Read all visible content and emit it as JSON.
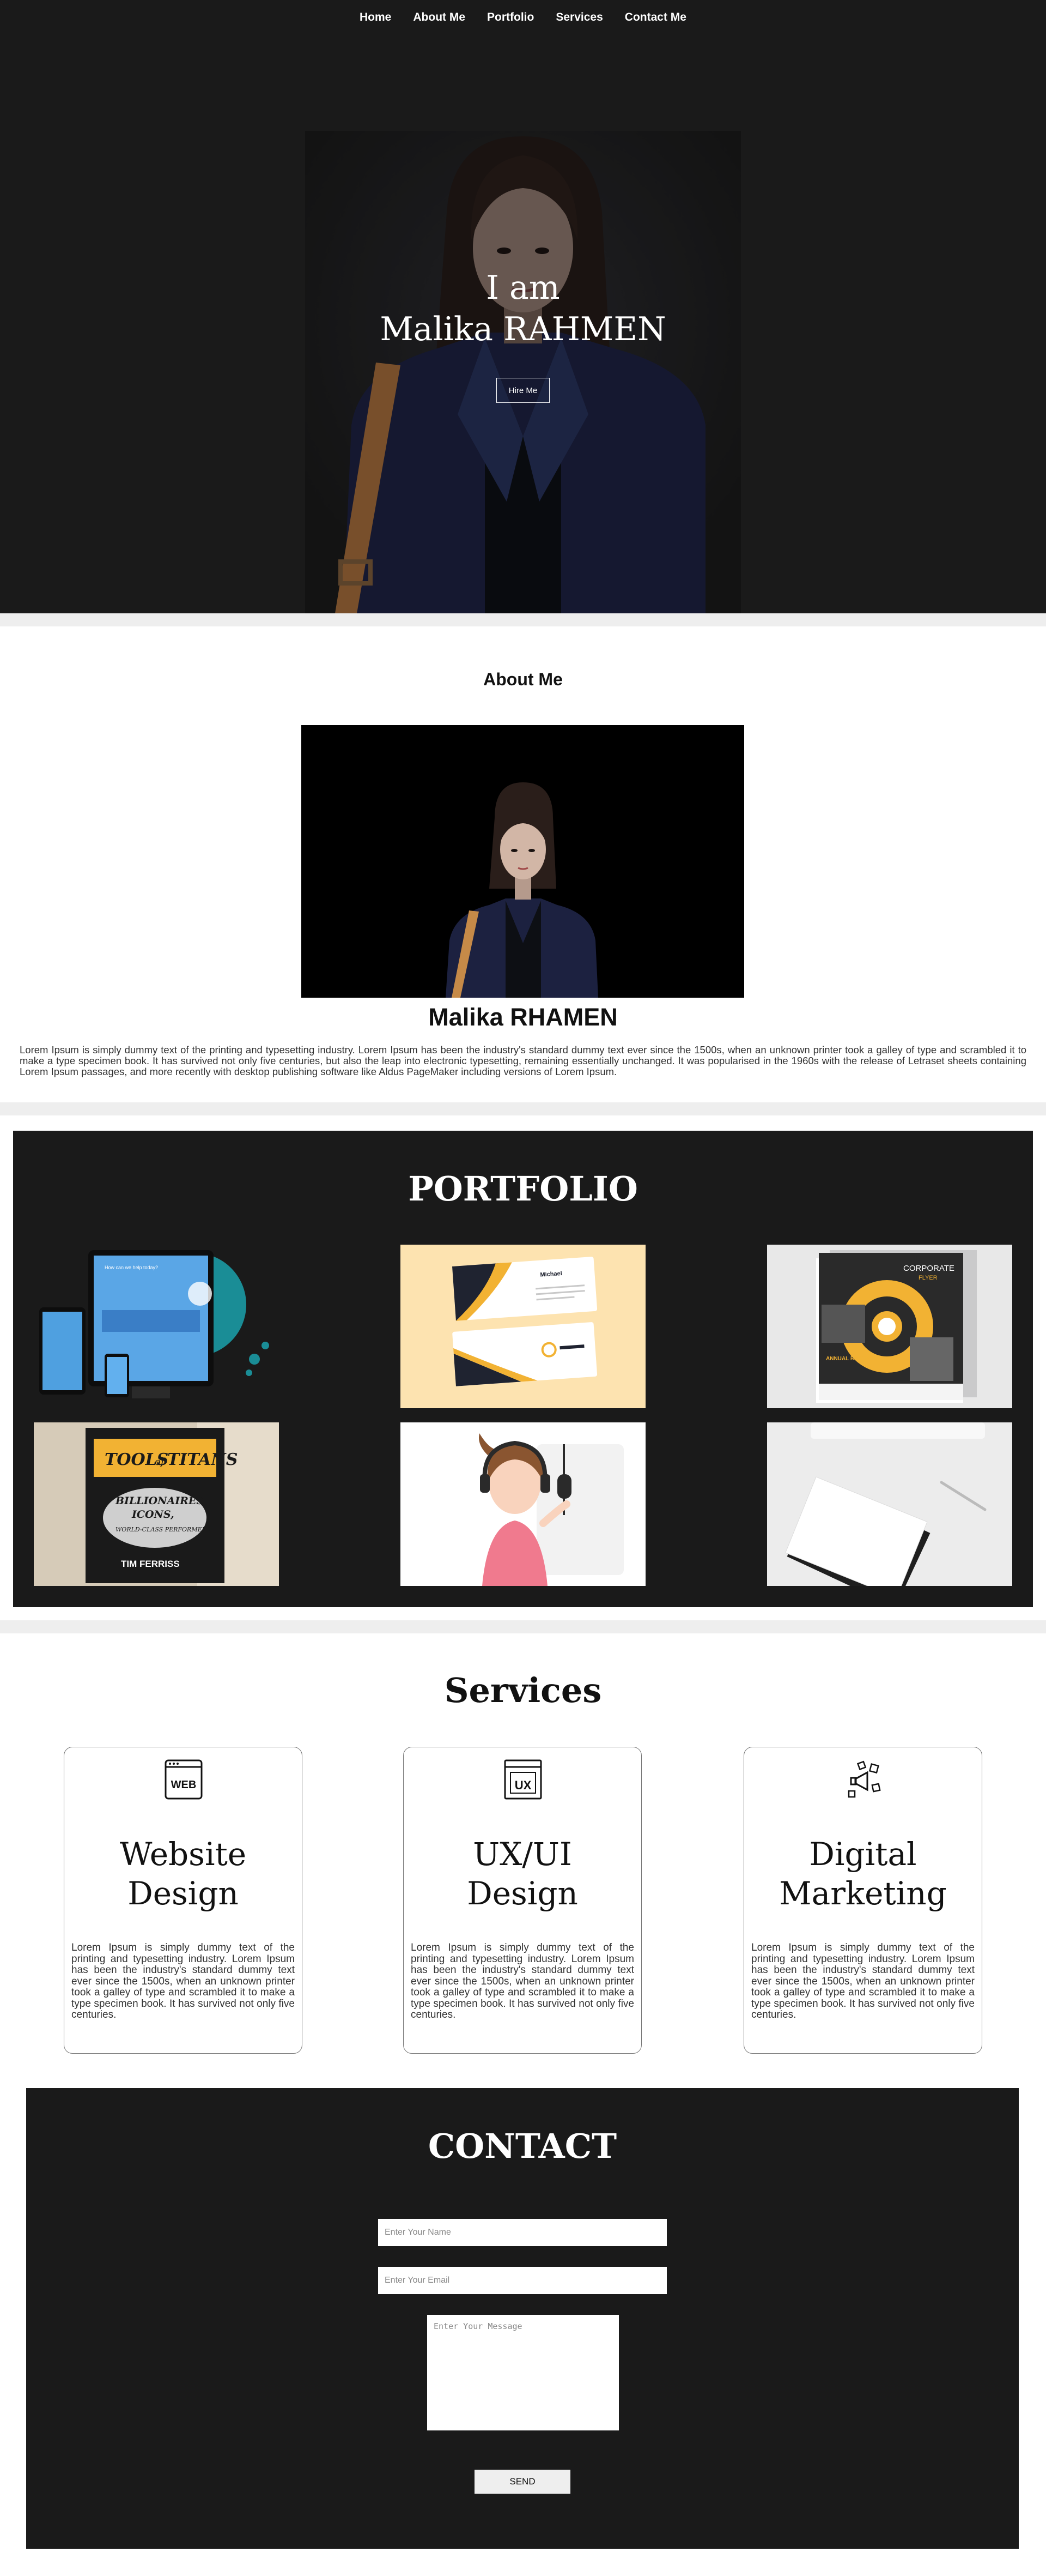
{
  "nav": {
    "items": [
      "Home",
      "About Me",
      "Portfolio",
      "Services",
      "Contact Me"
    ]
  },
  "hero": {
    "line1": "I am",
    "line2": "Malika RAHMEN",
    "cta_label": "Hire Me"
  },
  "about": {
    "title": "About Me",
    "name": "Malika RHAMEN",
    "description": "Lorem Ipsum is simply dummy text of the printing and typesetting industry. Lorem Ipsum has been the industry's standard dummy text ever since the 1500s, when an unknown printer took a galley of type and scrambled it to make a type specimen book. It has survived not only five centuries, but also the leap into electronic typesetting, remaining essentially unchanged. It was popularised in the 1960s with the release of Letraset sheets containing Lorem Ipsum passages, and more recently with desktop publishing software like Aldus PageMaker including versions of Lorem Ipsum."
  },
  "portfolio": {
    "title": "PORTFOLIO",
    "items": [
      {
        "name": "responsive-website-mockup",
        "screen_heading": "How can we help today?"
      },
      {
        "name": "business-cards-design",
        "card_name": "Michael"
      },
      {
        "name": "corporate-flyer-design",
        "flyer_heading": "CORPORATE",
        "flyer_sub": "FLYER",
        "flyer_label": "ANNUAL REPORT"
      },
      {
        "name": "book-cover-design",
        "book_title_1": "TOOLS",
        "book_title_2": "of",
        "book_title_3": "TITANS",
        "book_sub_1": "BILLIONAIRES,",
        "book_sub_2": "ICONS,",
        "book_sub_3": "WORLD-CLASS PERFORMERS",
        "book_author": "TIM FERRISS"
      },
      {
        "name": "podcast-illustration"
      },
      {
        "name": "stationery-papers"
      }
    ]
  },
  "services": {
    "title": "Services",
    "cards": [
      {
        "title_line1": "Website",
        "title_line2": "Design",
        "icon": "web-icon",
        "icon_text": "WEB",
        "text": "Lorem Ipsum is simply dummy text of the printing and typesetting industry. Lorem Ipsum has been the industry's standard dummy text ever since the 1500s, when an unknown printer took a galley of type and scrambled it to make a type specimen book. It has survived not only five centuries."
      },
      {
        "title_line1": "UX/UI",
        "title_line2": "Design",
        "icon": "ux-icon",
        "icon_text": "UX",
        "text": "Lorem Ipsum is simply dummy text of the printing and typesetting industry. Lorem Ipsum has been the industry's standard dummy text ever since the 1500s, when an unknown printer took a galley of type and scrambled it to make a type specimen book. It has survived not only five centuries."
      },
      {
        "title_line1": "Digital",
        "title_line2": "Marketing",
        "icon": "marketing-icon",
        "text": "Lorem Ipsum is simply dummy text of the printing and typesetting industry. Lorem Ipsum has been the industry's standard dummy text ever since the 1500s, when an unknown printer took a galley of type and scrambled it to make a type specimen book. It has survived not only five centuries."
      }
    ]
  },
  "contact": {
    "title": "CONTACT",
    "name_placeholder": "Enter Your Name",
    "email_placeholder": "Enter Your Email",
    "message_placeholder": "Enter Your Message",
    "send_label": "SEND"
  },
  "colors": {
    "dark_bg": "#1a1a1a",
    "light_separator": "#eeeeee",
    "accent_yellow": "#f2b233",
    "teal": "#1a8d96"
  }
}
